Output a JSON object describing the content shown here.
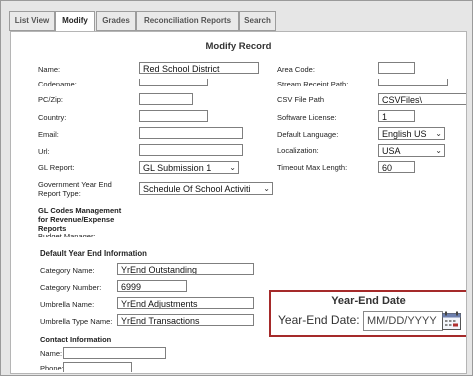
{
  "tabs": [
    "List View",
    "Modify",
    "Grades",
    "Reconciliation Reports",
    "Search"
  ],
  "title": "Modify Record",
  "left_fields": {
    "name_label": "Name:",
    "name_value": "Red School District",
    "cut_label": "Codename:",
    "pczip_label": "PC/Zip:",
    "country_label": "Country:",
    "email_label": "Email:",
    "url_label": "Url:",
    "glreport_label": "GL Report:",
    "glreport_value": "GL Submission 1",
    "govyear_label_1": "Government Year End",
    "govyear_label_2": "Report Type:",
    "govyear_value": "Schedule Of School Activiti"
  },
  "right_fields": {
    "areacode_label": "Area Code:",
    "cut_label": "Stream Receipt Path:",
    "csvpath_label": "CSV File Path",
    "csvpath_value": "CSVFiles\\",
    "license_label": "Software License:",
    "license_value": "1",
    "language_label": "Default Language:",
    "language_value": "English US",
    "localization_label": "Localization:",
    "localization_value": "USA",
    "timeout_label": "Timeout Max Length:",
    "timeout_value": "60"
  },
  "gl_codes": {
    "heading_1": "GL Codes Management",
    "heading_2": "for Revenue/Expense",
    "heading_3": "Reports",
    "cut_text": "Budget Manager:"
  },
  "year_end": {
    "heading": "Default Year End Information",
    "category_name_label": "Category Name:",
    "category_name_value": "YrEnd Outstanding",
    "category_number_label": "Category Number:",
    "category_number_value": "6999",
    "umbrella_name_label": "Umbrella Name:",
    "umbrella_name_value": "YrEnd Adjustments",
    "umbrella_type_label": "Umbrella Type Name:",
    "umbrella_type_value": "YrEnd Transactions"
  },
  "contact": {
    "heading": "Contact Information",
    "name_label": "Name:",
    "phone_label": "Phone:"
  },
  "popup": {
    "title": "Year-End Date",
    "label": "Year-End Date:",
    "placeholder": "MM/DD/YYYY"
  },
  "colors": {
    "popup_border": "#a52a2a",
    "calendar_icon_accent": "#b03030"
  }
}
